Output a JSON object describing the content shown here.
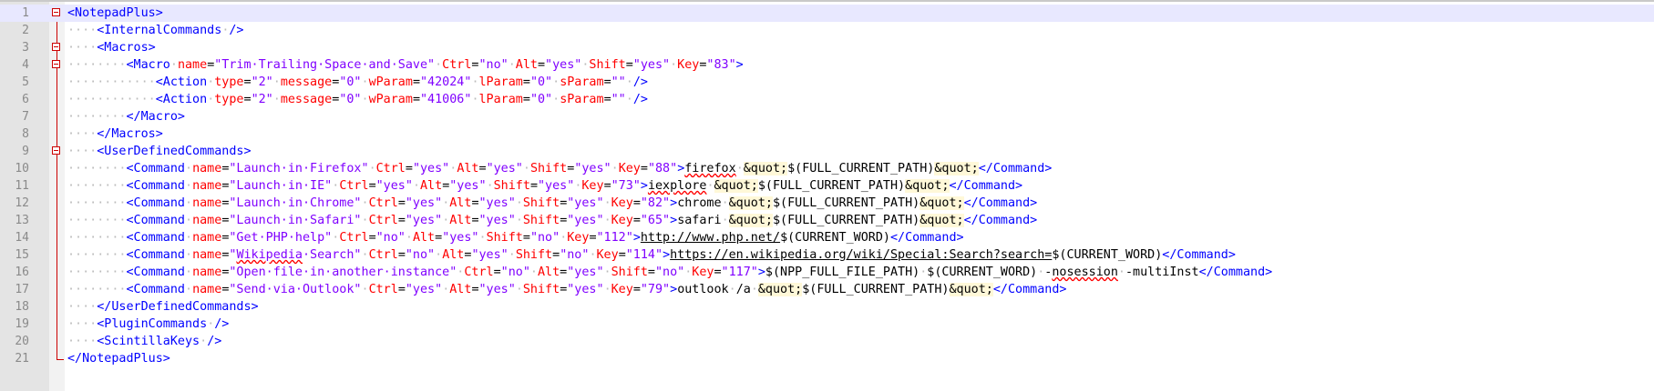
{
  "editor": {
    "app": "Notepad++",
    "language": "XML",
    "current_line": 1
  },
  "colors": {
    "tag": "#0000ff",
    "attribute": "#ff0000",
    "value": "#8000ff",
    "text": "#000000",
    "fold_marker": "#cc0000",
    "line_number": "#8a8a8a",
    "current_line_bg": "#e8e8ff"
  },
  "lines": [
    {
      "n": "1",
      "fold": "open",
      "segs": [
        [
          "b",
          "<NotepadPlus>"
        ]
      ]
    },
    {
      "n": "2",
      "segs": [
        [
          "w",
          "····"
        ],
        [
          "b",
          "<InternalCommands"
        ],
        [
          "w",
          "·"
        ],
        [
          "b",
          "/>"
        ]
      ]
    },
    {
      "n": "3",
      "fold": "open",
      "segs": [
        [
          "w",
          "····"
        ],
        [
          "b",
          "<Macros>"
        ]
      ]
    },
    {
      "n": "4",
      "fold": "open",
      "segs": [
        [
          "w",
          "········"
        ],
        [
          "b",
          "<Macro"
        ],
        [
          "w",
          "·"
        ],
        [
          "a",
          "name"
        ],
        [
          "t",
          "="
        ],
        [
          "v",
          "\"Trim·Trailing·Space·and·Save\""
        ],
        [
          "w",
          "·"
        ],
        [
          "a",
          "Ctrl"
        ],
        [
          "t",
          "="
        ],
        [
          "v",
          "\"no\""
        ],
        [
          "w",
          "·"
        ],
        [
          "a",
          "Alt"
        ],
        [
          "t",
          "="
        ],
        [
          "v",
          "\"yes\""
        ],
        [
          "w",
          "·"
        ],
        [
          "a",
          "Shift"
        ],
        [
          "t",
          "="
        ],
        [
          "v",
          "\"yes\""
        ],
        [
          "w",
          "·"
        ],
        [
          "a",
          "Key"
        ],
        [
          "t",
          "="
        ],
        [
          "v",
          "\"83\""
        ],
        [
          "b",
          ">"
        ]
      ]
    },
    {
      "n": "5",
      "segs": [
        [
          "w",
          "············"
        ],
        [
          "b",
          "<Action"
        ],
        [
          "w",
          "·"
        ],
        [
          "a",
          "type"
        ],
        [
          "t",
          "="
        ],
        [
          "v",
          "\"2\""
        ],
        [
          "w",
          "·"
        ],
        [
          "a",
          "message"
        ],
        [
          "t",
          "="
        ],
        [
          "v",
          "\"0\""
        ],
        [
          "w",
          "·"
        ],
        [
          "a",
          "wParam"
        ],
        [
          "t",
          "="
        ],
        [
          "v",
          "\"42024\""
        ],
        [
          "w",
          "·"
        ],
        [
          "a",
          "lParam"
        ],
        [
          "t",
          "="
        ],
        [
          "v",
          "\"0\""
        ],
        [
          "w",
          "·"
        ],
        [
          "a",
          "sParam"
        ],
        [
          "t",
          "="
        ],
        [
          "v",
          "\"\""
        ],
        [
          "w",
          "·"
        ],
        [
          "b",
          "/>"
        ]
      ]
    },
    {
      "n": "6",
      "segs": [
        [
          "w",
          "············"
        ],
        [
          "b",
          "<Action"
        ],
        [
          "w",
          "·"
        ],
        [
          "a",
          "type"
        ],
        [
          "t",
          "="
        ],
        [
          "v",
          "\"2\""
        ],
        [
          "w",
          "·"
        ],
        [
          "a",
          "message"
        ],
        [
          "t",
          "="
        ],
        [
          "v",
          "\"0\""
        ],
        [
          "w",
          "·"
        ],
        [
          "a",
          "wParam"
        ],
        [
          "t",
          "="
        ],
        [
          "v",
          "\"41006\""
        ],
        [
          "w",
          "·"
        ],
        [
          "a",
          "lParam"
        ],
        [
          "t",
          "="
        ],
        [
          "v",
          "\"0\""
        ],
        [
          "w",
          "·"
        ],
        [
          "a",
          "sParam"
        ],
        [
          "t",
          "="
        ],
        [
          "v",
          "\"\""
        ],
        [
          "w",
          "·"
        ],
        [
          "b",
          "/>"
        ]
      ]
    },
    {
      "n": "7",
      "segs": [
        [
          "w",
          "········"
        ],
        [
          "b",
          "</Macro>"
        ]
      ]
    },
    {
      "n": "8",
      "segs": [
        [
          "w",
          "····"
        ],
        [
          "b",
          "</Macros>"
        ]
      ]
    },
    {
      "n": "9",
      "fold": "open",
      "segs": [
        [
          "w",
          "····"
        ],
        [
          "b",
          "<UserDefinedCommands>"
        ]
      ]
    },
    {
      "n": "10",
      "segs": [
        [
          "w",
          "········"
        ],
        [
          "b",
          "<Command"
        ],
        [
          "w",
          "·"
        ],
        [
          "a",
          "name"
        ],
        [
          "t",
          "="
        ],
        [
          "v",
          "\"Launch·in·Firefox\""
        ],
        [
          "w",
          "·"
        ],
        [
          "a",
          "Ctrl"
        ],
        [
          "t",
          "="
        ],
        [
          "v",
          "\"yes\""
        ],
        [
          "w",
          "·"
        ],
        [
          "a",
          "Alt"
        ],
        [
          "t",
          "="
        ],
        [
          "v",
          "\"yes\""
        ],
        [
          "w",
          "·"
        ],
        [
          "a",
          "Shift"
        ],
        [
          "t",
          "="
        ],
        [
          "v",
          "\"yes\""
        ],
        [
          "w",
          "·"
        ],
        [
          "a",
          "Key"
        ],
        [
          "t",
          "="
        ],
        [
          "v",
          "\"88\""
        ],
        [
          "b",
          ">"
        ],
        [
          "tu",
          "firefox"
        ],
        [
          "w",
          "·"
        ],
        [
          "e",
          "&quot;"
        ],
        [
          "t",
          "$(FULL_CURRENT_PATH)"
        ],
        [
          "e",
          "&quot;"
        ],
        [
          "b",
          "</Command>"
        ]
      ]
    },
    {
      "n": "11",
      "segs": [
        [
          "w",
          "········"
        ],
        [
          "b",
          "<Command"
        ],
        [
          "w",
          "·"
        ],
        [
          "a",
          "name"
        ],
        [
          "t",
          "="
        ],
        [
          "v",
          "\"Launch·in·IE\""
        ],
        [
          "w",
          "·"
        ],
        [
          "a",
          "Ctrl"
        ],
        [
          "t",
          "="
        ],
        [
          "v",
          "\"yes\""
        ],
        [
          "w",
          "·"
        ],
        [
          "a",
          "Alt"
        ],
        [
          "t",
          "="
        ],
        [
          "v",
          "\"yes\""
        ],
        [
          "w",
          "·"
        ],
        [
          "a",
          "Shift"
        ],
        [
          "t",
          "="
        ],
        [
          "v",
          "\"yes\""
        ],
        [
          "w",
          "·"
        ],
        [
          "a",
          "Key"
        ],
        [
          "t",
          "="
        ],
        [
          "v",
          "\"73\""
        ],
        [
          "b",
          ">"
        ],
        [
          "tu",
          "iexplore"
        ],
        [
          "w",
          "·"
        ],
        [
          "e",
          "&quot;"
        ],
        [
          "t",
          "$(FULL_CURRENT_PATH)"
        ],
        [
          "e",
          "&quot;"
        ],
        [
          "b",
          "</Command>"
        ]
      ]
    },
    {
      "n": "12",
      "segs": [
        [
          "w",
          "········"
        ],
        [
          "b",
          "<Command"
        ],
        [
          "w",
          "·"
        ],
        [
          "a",
          "name"
        ],
        [
          "t",
          "="
        ],
        [
          "v",
          "\"Launch·in·Chrome\""
        ],
        [
          "w",
          "·"
        ],
        [
          "a",
          "Ctrl"
        ],
        [
          "t",
          "="
        ],
        [
          "v",
          "\"yes\""
        ],
        [
          "w",
          "·"
        ],
        [
          "a",
          "Alt"
        ],
        [
          "t",
          "="
        ],
        [
          "v",
          "\"yes\""
        ],
        [
          "w",
          "·"
        ],
        [
          "a",
          "Shift"
        ],
        [
          "t",
          "="
        ],
        [
          "v",
          "\"yes\""
        ],
        [
          "w",
          "·"
        ],
        [
          "a",
          "Key"
        ],
        [
          "t",
          "="
        ],
        [
          "v",
          "\"82\""
        ],
        [
          "b",
          ">"
        ],
        [
          "t",
          "chrome"
        ],
        [
          "w",
          "·"
        ],
        [
          "e",
          "&quot;"
        ],
        [
          "t",
          "$(FULL_CURRENT_PATH)"
        ],
        [
          "e",
          "&quot;"
        ],
        [
          "b",
          "</Command>"
        ]
      ]
    },
    {
      "n": "13",
      "segs": [
        [
          "w",
          "········"
        ],
        [
          "b",
          "<Command"
        ],
        [
          "w",
          "·"
        ],
        [
          "a",
          "name"
        ],
        [
          "t",
          "="
        ],
        [
          "v",
          "\"Launch·in·Safari\""
        ],
        [
          "w",
          "·"
        ],
        [
          "a",
          "Ctrl"
        ],
        [
          "t",
          "="
        ],
        [
          "v",
          "\"yes\""
        ],
        [
          "w",
          "·"
        ],
        [
          "a",
          "Alt"
        ],
        [
          "t",
          "="
        ],
        [
          "v",
          "\"yes\""
        ],
        [
          "w",
          "·"
        ],
        [
          "a",
          "Shift"
        ],
        [
          "t",
          "="
        ],
        [
          "v",
          "\"yes\""
        ],
        [
          "w",
          "·"
        ],
        [
          "a",
          "Key"
        ],
        [
          "t",
          "="
        ],
        [
          "v",
          "\"65\""
        ],
        [
          "b",
          ">"
        ],
        [
          "t",
          "safari"
        ],
        [
          "w",
          "·"
        ],
        [
          "e",
          "&quot;"
        ],
        [
          "t",
          "$(FULL_CURRENT_PATH)"
        ],
        [
          "e",
          "&quot;"
        ],
        [
          "b",
          "</Command>"
        ]
      ]
    },
    {
      "n": "14",
      "segs": [
        [
          "w",
          "········"
        ],
        [
          "b",
          "<Command"
        ],
        [
          "w",
          "·"
        ],
        [
          "a",
          "name"
        ],
        [
          "t",
          "="
        ],
        [
          "v",
          "\"Get·PHP·help\""
        ],
        [
          "w",
          "·"
        ],
        [
          "a",
          "Ctrl"
        ],
        [
          "t",
          "="
        ],
        [
          "v",
          "\"no\""
        ],
        [
          "w",
          "·"
        ],
        [
          "a",
          "Alt"
        ],
        [
          "t",
          "="
        ],
        [
          "v",
          "\"yes\""
        ],
        [
          "w",
          "·"
        ],
        [
          "a",
          "Shift"
        ],
        [
          "t",
          "="
        ],
        [
          "v",
          "\"no\""
        ],
        [
          "w",
          "·"
        ],
        [
          "a",
          "Key"
        ],
        [
          "t",
          "="
        ],
        [
          "v",
          "\"112\""
        ],
        [
          "b",
          ">"
        ],
        [
          "u",
          "http://www.php.net/"
        ],
        [
          "t",
          "$(CURRENT_WORD)"
        ],
        [
          "b",
          "</Command>"
        ]
      ]
    },
    {
      "n": "15",
      "segs": [
        [
          "w",
          "········"
        ],
        [
          "b",
          "<Command"
        ],
        [
          "w",
          "·"
        ],
        [
          "a",
          "name"
        ],
        [
          "t",
          "="
        ],
        [
          "v",
          "\""
        ],
        [
          "vs",
          "Wikipedia"
        ],
        [
          "v",
          "·Search\""
        ],
        [
          "w",
          "·"
        ],
        [
          "a",
          "Ctrl"
        ],
        [
          "t",
          "="
        ],
        [
          "v",
          "\"no\""
        ],
        [
          "w",
          "·"
        ],
        [
          "a",
          "Alt"
        ],
        [
          "t",
          "="
        ],
        [
          "v",
          "\"yes\""
        ],
        [
          "w",
          "·"
        ],
        [
          "a",
          "Shift"
        ],
        [
          "t",
          "="
        ],
        [
          "v",
          "\"no\""
        ],
        [
          "w",
          "·"
        ],
        [
          "a",
          "Key"
        ],
        [
          "t",
          "="
        ],
        [
          "v",
          "\"114\""
        ],
        [
          "b",
          ">"
        ],
        [
          "u",
          "https://en.wikipedia.org/wiki/Special:Search?search="
        ],
        [
          "t",
          "$(CURRENT_WORD)"
        ],
        [
          "b",
          "</Command>"
        ]
      ]
    },
    {
      "n": "16",
      "segs": [
        [
          "w",
          "········"
        ],
        [
          "b",
          "<Command"
        ],
        [
          "w",
          "·"
        ],
        [
          "a",
          "name"
        ],
        [
          "t",
          "="
        ],
        [
          "v",
          "\"Open·file·in·another·instance\""
        ],
        [
          "w",
          "·"
        ],
        [
          "a",
          "Ctrl"
        ],
        [
          "t",
          "="
        ],
        [
          "v",
          "\"no\""
        ],
        [
          "w",
          "·"
        ],
        [
          "a",
          "Alt"
        ],
        [
          "t",
          "="
        ],
        [
          "v",
          "\"yes\""
        ],
        [
          "w",
          "·"
        ],
        [
          "a",
          "Shift"
        ],
        [
          "t",
          "="
        ],
        [
          "v",
          "\"no\""
        ],
        [
          "w",
          "·"
        ],
        [
          "a",
          "Key"
        ],
        [
          "t",
          "="
        ],
        [
          "v",
          "\"117\""
        ],
        [
          "b",
          ">"
        ],
        [
          "t",
          "$(NPP_FULL_FILE_PATH)"
        ],
        [
          "w",
          "·"
        ],
        [
          "t",
          "$(CURRENT_WORD)"
        ],
        [
          "w",
          "·"
        ],
        [
          "t",
          "-"
        ],
        [
          "ts",
          "nosession"
        ],
        [
          "w",
          "·"
        ],
        [
          "t",
          "-multiInst"
        ],
        [
          "b",
          "</Command>"
        ]
      ]
    },
    {
      "n": "17",
      "segs": [
        [
          "w",
          "········"
        ],
        [
          "b",
          "<Command"
        ],
        [
          "w",
          "·"
        ],
        [
          "a",
          "name"
        ],
        [
          "t",
          "="
        ],
        [
          "v",
          "\"Send·via·Outlook\""
        ],
        [
          "w",
          "·"
        ],
        [
          "a",
          "Ctrl"
        ],
        [
          "t",
          "="
        ],
        [
          "v",
          "\"yes\""
        ],
        [
          "w",
          "·"
        ],
        [
          "a",
          "Alt"
        ],
        [
          "t",
          "="
        ],
        [
          "v",
          "\"yes\""
        ],
        [
          "w",
          "·"
        ],
        [
          "a",
          "Shift"
        ],
        [
          "t",
          "="
        ],
        [
          "v",
          "\"yes\""
        ],
        [
          "w",
          "·"
        ],
        [
          "a",
          "Key"
        ],
        [
          "t",
          "="
        ],
        [
          "v",
          "\"79\""
        ],
        [
          "b",
          ">"
        ],
        [
          "t",
          "outlook"
        ],
        [
          "w",
          "·"
        ],
        [
          "t",
          "/a"
        ],
        [
          "w",
          "·"
        ],
        [
          "e",
          "&quot;"
        ],
        [
          "t",
          "$(FULL_CURRENT_PATH)"
        ],
        [
          "e",
          "&quot;"
        ],
        [
          "b",
          "</Command>"
        ]
      ]
    },
    {
      "n": "18",
      "segs": [
        [
          "w",
          "····"
        ],
        [
          "b",
          "</UserDefinedCommands>"
        ]
      ]
    },
    {
      "n": "19",
      "segs": [
        [
          "w",
          "····"
        ],
        [
          "b",
          "<PluginCommands"
        ],
        [
          "w",
          "·"
        ],
        [
          "b",
          "/>"
        ]
      ]
    },
    {
      "n": "20",
      "segs": [
        [
          "w",
          "····"
        ],
        [
          "b",
          "<ScintillaKeys"
        ],
        [
          "w",
          "·"
        ],
        [
          "b",
          "/>"
        ]
      ]
    },
    {
      "n": "21",
      "segs": [
        [
          "b",
          "</NotepadPlus>"
        ]
      ]
    }
  ]
}
